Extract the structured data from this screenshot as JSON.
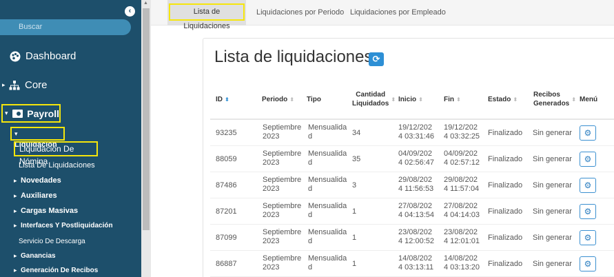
{
  "sidebar": {
    "search_placeholder": "Buscar",
    "items": [
      {
        "label": "Dashboard"
      },
      {
        "label": "Core"
      },
      {
        "label": "Payroll"
      }
    ],
    "payroll_children": {
      "liquidacion": "Liquidación",
      "liquidacion_nomina": "Liquidación De Nómina",
      "lista_liquidaciones": "Lista De Liquidaciones",
      "novedades": "Novedades",
      "auxiliares": "Auxiliares",
      "cargas_masivas": "Cargas Masivas",
      "interfaces": "Interfaces Y Postliquidación",
      "servicio_descarga": "Servicio De Descarga",
      "ganancias": "Ganancias",
      "generacion_recibos": "Generación De Recibos"
    }
  },
  "tabs": [
    {
      "label": "Lista de Liquidaciones"
    },
    {
      "label": "Liquidaciones por Periodo"
    },
    {
      "label": "Liquidaciones por Empleado"
    }
  ],
  "page": {
    "title": "Lista de liquidaciones"
  },
  "table": {
    "headers": {
      "id": "ID",
      "periodo": "Periodo",
      "tipo": "Tipo",
      "cantidad_1": "Cantidad",
      "cantidad_2": "Liquidados",
      "inicio": "Inicio",
      "fin": "Fin",
      "estado": "Estado",
      "recibos_1": "Recibos",
      "recibos_2": "Generados",
      "menu": "Menú"
    },
    "rows": [
      {
        "id": "93235",
        "periodo_1": "Septiembre",
        "periodo_2": "2023",
        "tipo_1": "Mensualida",
        "tipo_2": "d",
        "cantidad": "34",
        "inicio_1": "19/12/202",
        "inicio_2": "4 03:31:46",
        "fin_1": "19/12/202",
        "fin_2": "4 03:32:25",
        "estado": "Finalizado",
        "recibos": "Sin generar"
      },
      {
        "id": "88059",
        "periodo_1": "Septiembre",
        "periodo_2": "2023",
        "tipo_1": "Mensualida",
        "tipo_2": "d",
        "cantidad": "35",
        "inicio_1": "04/09/202",
        "inicio_2": "4 02:56:47",
        "fin_1": "04/09/202",
        "fin_2": "4 02:57:12",
        "estado": "Finalizado",
        "recibos": "Sin generar"
      },
      {
        "id": "87486",
        "periodo_1": "Septiembre",
        "periodo_2": "2023",
        "tipo_1": "Mensualida",
        "tipo_2": "d",
        "cantidad": "3",
        "inicio_1": "29/08/202",
        "inicio_2": "4 11:56:53",
        "fin_1": "29/08/202",
        "fin_2": "4 11:57:04",
        "estado": "Finalizado",
        "recibos": "Sin generar"
      },
      {
        "id": "87201",
        "periodo_1": "Septiembre",
        "periodo_2": "2023",
        "tipo_1": "Mensualida",
        "tipo_2": "d",
        "cantidad": "1",
        "inicio_1": "27/08/202",
        "inicio_2": "4 04:13:54",
        "fin_1": "27/08/202",
        "fin_2": "4 04:14:03",
        "estado": "Finalizado",
        "recibos": "Sin generar"
      },
      {
        "id": "87099",
        "periodo_1": "Septiembre",
        "periodo_2": "2023",
        "tipo_1": "Mensualida",
        "tipo_2": "d",
        "cantidad": "1",
        "inicio_1": "23/08/202",
        "inicio_2": "4 12:00:52",
        "fin_1": "23/08/202",
        "fin_2": "4 12:01:01",
        "estado": "Finalizado",
        "recibos": "Sin generar"
      },
      {
        "id": "86887",
        "periodo_1": "Septiembre",
        "periodo_2": "2023",
        "tipo_1": "Mensualida",
        "tipo_2": "d",
        "cantidad": "1",
        "inicio_1": "14/08/202",
        "inicio_2": "4 03:13:11",
        "fin_1": "14/08/202",
        "fin_2": "4 03:13:20",
        "estado": "Finalizado",
        "recibos": "Sin generar"
      }
    ]
  },
  "colors": {
    "sidebar_bg": "#1d4f6b",
    "highlight": "#f6e60b",
    "accent": "#2d8fd5"
  },
  "icons": [
    "collapse-chevron-left-icon",
    "dashboard-palette-icon",
    "sitemap-icon",
    "money-bill-icon",
    "refresh-icon",
    "gear-icon",
    "sort-icon"
  ]
}
